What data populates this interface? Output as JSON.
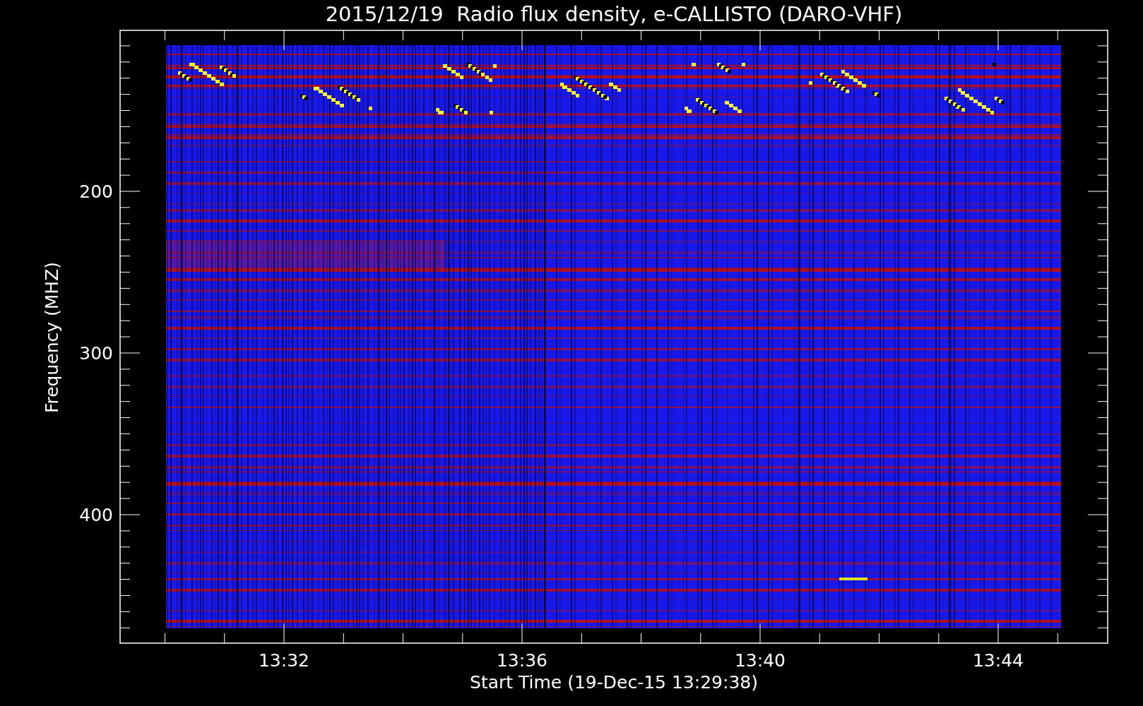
{
  "title": "2015/12/19  Radio flux density, e-CALLISTO (DARO-VHF)",
  "y_axis": {
    "label": "Frequency (MHZ)",
    "tick_labels": [
      "200",
      "300",
      "400"
    ]
  },
  "x_axis": {
    "label": "Start Time (19-Dec-15 13:29:38)",
    "tick_labels": [
      "13:32",
      "13:36",
      "13:40",
      "13:44"
    ]
  }
}
